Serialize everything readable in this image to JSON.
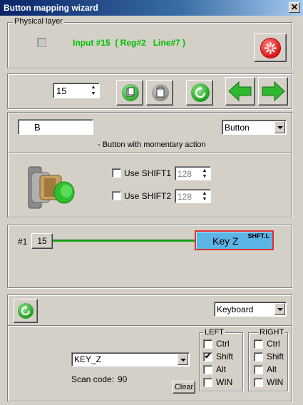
{
  "window": {
    "title": "Button mapping wizard",
    "close_label": "✕"
  },
  "physical": {
    "legend": "Physical layer",
    "input_text": "Input #15  ( Reg#2   Line#7 )"
  },
  "toolbar": {
    "input_number": "15"
  },
  "button_panel": {
    "name_value": "B",
    "type_selected": "Button",
    "description": "- Button with momentary action",
    "shift1_label": "Use SHIFT1",
    "shift1_value": "128",
    "shift2_label": "Use SHIFT2",
    "shift2_value": "128"
  },
  "mapping": {
    "row_label": "#1",
    "input_chip": "15",
    "key_label": "Key Z",
    "key_modifier": "SHFT.L"
  },
  "output": {
    "device_selected": "Keyboard",
    "key_selected": "KEY_Z",
    "scan_code_label": "Scan code:",
    "scan_code_value": "90",
    "clear_label": "Clear",
    "left_legend": "LEFT",
    "right_legend": "RIGHT",
    "left_mods": [
      {
        "label": "Ctrl",
        "checked": false
      },
      {
        "label": "Shift",
        "checked": true
      },
      {
        "label": "Alt",
        "checked": false
      },
      {
        "label": "WIN",
        "checked": false
      }
    ],
    "right_mods": [
      {
        "label": "Ctrl",
        "checked": false
      },
      {
        "label": "Shift",
        "checked": false
      },
      {
        "label": "Alt",
        "checked": false
      },
      {
        "label": "WIN",
        "checked": false
      }
    ],
    "check_mark": "✔"
  },
  "colors": {
    "accent_green": "#1fa81f",
    "input_text_green": "#00c000",
    "key_box": "#5bb4e6",
    "key_border": "#e03030"
  }
}
